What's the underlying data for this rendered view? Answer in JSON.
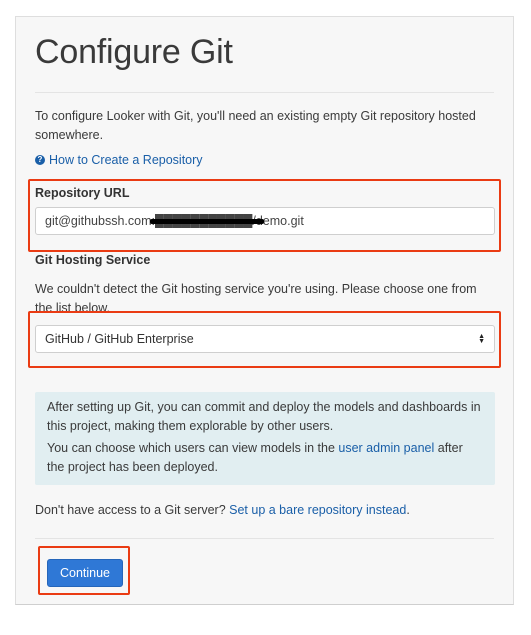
{
  "page": {
    "title": "Configure Git",
    "intro": "To configure Looker with Git, you'll need an existing empty Git repository hosted somewhere.",
    "help_link": {
      "icon": "question-circle-icon",
      "label": "How to Create a Repository"
    }
  },
  "repository": {
    "label": "Repository URL",
    "value": "git@githubssh.com:███████████/demo.git"
  },
  "hosting": {
    "label": "Git Hosting Service",
    "help_text": "We couldn't detect the Git hosting service you're using. Please choose one from the list below.",
    "selected": "GitHub / GitHub Enterprise"
  },
  "info_box": {
    "line1": "After setting up Git, you can commit and deploy the models and dashboards in this project, making them explorable by other users.",
    "line2_before": "You can choose which users can view models in the ",
    "line2_link": "user admin panel",
    "line2_after": " after the project has been deployed."
  },
  "bare_repo": {
    "prefix": "Don't have access to a Git server? ",
    "link": "Set up a bare repository instead",
    "suffix": "."
  },
  "actions": {
    "continue_label": "Continue"
  },
  "colors": {
    "accent": "#2f78d6",
    "link": "#1a5fa8",
    "highlight": "#ea3b13",
    "info_bg": "#e1eef1"
  }
}
